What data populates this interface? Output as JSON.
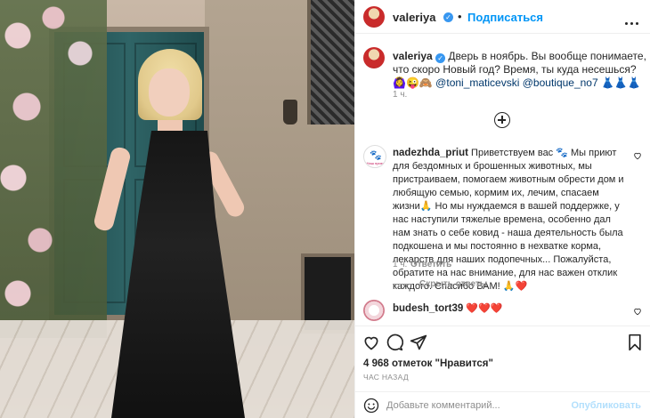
{
  "post_author": {
    "username": "valeriya",
    "verified_icon": "verified-badge-icon",
    "follow_label": "Подписаться",
    "separator": "•"
  },
  "caption": {
    "username": "valeriya",
    "text": " Дверь в ноябрь. Вы вообще понимаете, что скоро Новый год? Время, ты куда несешься? 🙆‍♀️😜🙈 ",
    "mention1": "@toni_maticevski",
    "mention2": "@boutique_no7",
    "tail": " 👗👗👗",
    "time": "1 ч."
  },
  "comments": [
    {
      "username": "nadezhda_priut",
      "text": " Приветствуем вас 🐾 Мы приют для бездомных и брошенных животных, мы пристраиваем, помогаем животным обрести дом и любящую семью, кормим их, лечим, спасаем жизни🙏 Но мы нуждаемся в вашей поддержке, у нас наступили тяжелые времена, особенно дал нам знать о себе ковид - наша деятельность была подкошена и мы постоянно в нехватке корма, лекарств для наших подопечных... Пожалуйста, обратите на нас внимание, для нас важен отклик каждого. Спасибо ВАМ! 🙏❤️",
      "time": "1 ч.",
      "reply_label": "Ответить",
      "avatar_caption": "Наш приют"
    },
    {
      "username": "budesh_tort39",
      "text": " ❤️❤️❤️"
    }
  ],
  "hide_replies_label": "Скрыть ответы",
  "likes_label": "4 968 отметок \"Нравится\"",
  "time_ago": "ЧАС НАЗАД",
  "composer": {
    "placeholder": "Добавьте комментарий...",
    "publish_label": "Опубликовать"
  },
  "colors": {
    "link_blue": "#0095f6",
    "mention": "#00376b",
    "muted": "#8e8e8e",
    "publish_disabled": "#b2dffc"
  }
}
